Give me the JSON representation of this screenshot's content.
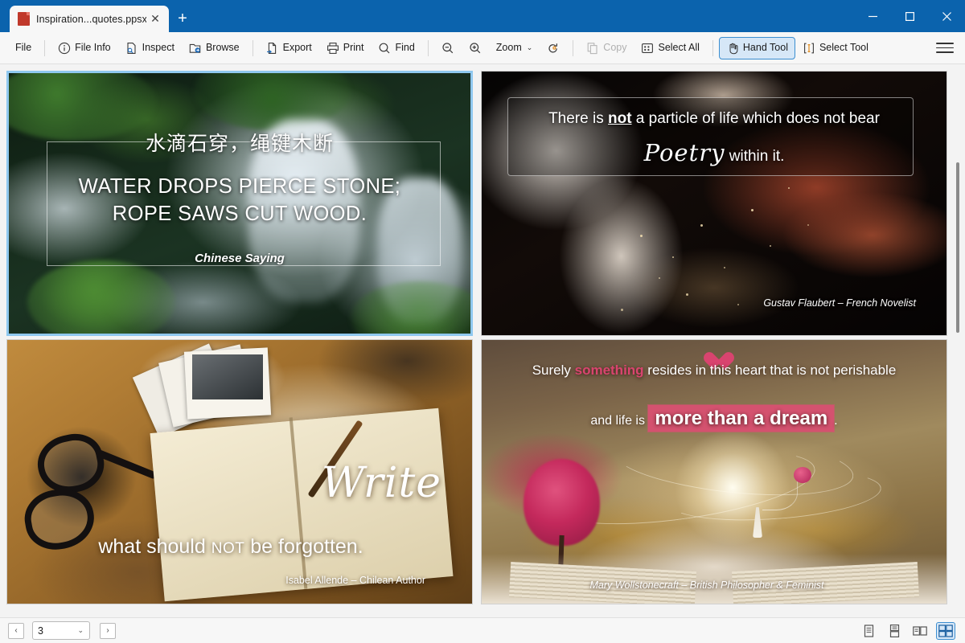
{
  "window": {
    "tab_title": "Inspiration...quotes.ppsx",
    "tab_close_glyph": "✕",
    "new_tab_glyph": "+",
    "accent_color": "#0b63ad"
  },
  "toolbar": {
    "file": "File",
    "file_info": "File Info",
    "inspect": "Inspect",
    "browse": "Browse",
    "export": "Export",
    "print": "Print",
    "find": "Find",
    "zoom": "Zoom",
    "caret": "⌄",
    "copy": "Copy",
    "select_all": "Select All",
    "hand_tool": "Hand Tool",
    "select_tool": "Select Tool"
  },
  "statusbar": {
    "prev_glyph": "‹",
    "next_glyph": "›",
    "page_value": "3",
    "page_chevron": "⌄"
  },
  "slides": [
    {
      "chinese": "水滴石穿，绳键木断",
      "english_line1": "WATER DROPS PIERCE STONE;",
      "english_line2": "ROPE SAWS CUT WOOD.",
      "attribution": "Chinese Saying"
    },
    {
      "line1_a": "There is ",
      "line1_bold": "not",
      "line1_b": " a particle of life which does not bear",
      "line2_script": "Poetry",
      "line2_rest": " within it.",
      "attribution": "Gustav Flaubert – French Novelist"
    },
    {
      "script": "Write",
      "line2_a": "what should ",
      "line2_smallcaps": "NOT",
      "line2_b": " be forgotten.",
      "attribution": "Isabel Allende – Chilean Author"
    },
    {
      "line1_a": "Surely ",
      "line1_highlight": "something",
      "line1_b": " resides in this heart that is not perishable",
      "line2_a": "and life is ",
      "line2_big": "more than a dream",
      "line2_b": ".",
      "attribution": "Mary Wollstonecraft – British Philosopher & Feminist",
      "highlight_color": "#d4526f"
    }
  ]
}
